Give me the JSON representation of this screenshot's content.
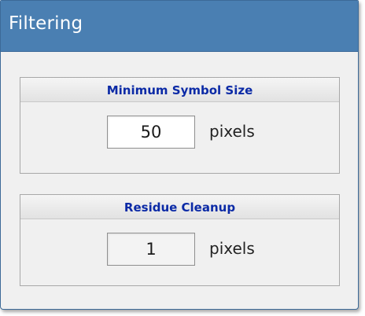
{
  "window": {
    "title": "Filtering"
  },
  "groups": [
    {
      "label": "Minimum Symbol Size",
      "value": "50",
      "unit": "pixels"
    },
    {
      "label": "Residue Cleanup",
      "value": "1",
      "unit": "pixels"
    }
  ],
  "colors": {
    "titlebar": "#4a7fb2",
    "group_label": "#0b2aa6",
    "panel_bg": "#f0f0f0"
  }
}
